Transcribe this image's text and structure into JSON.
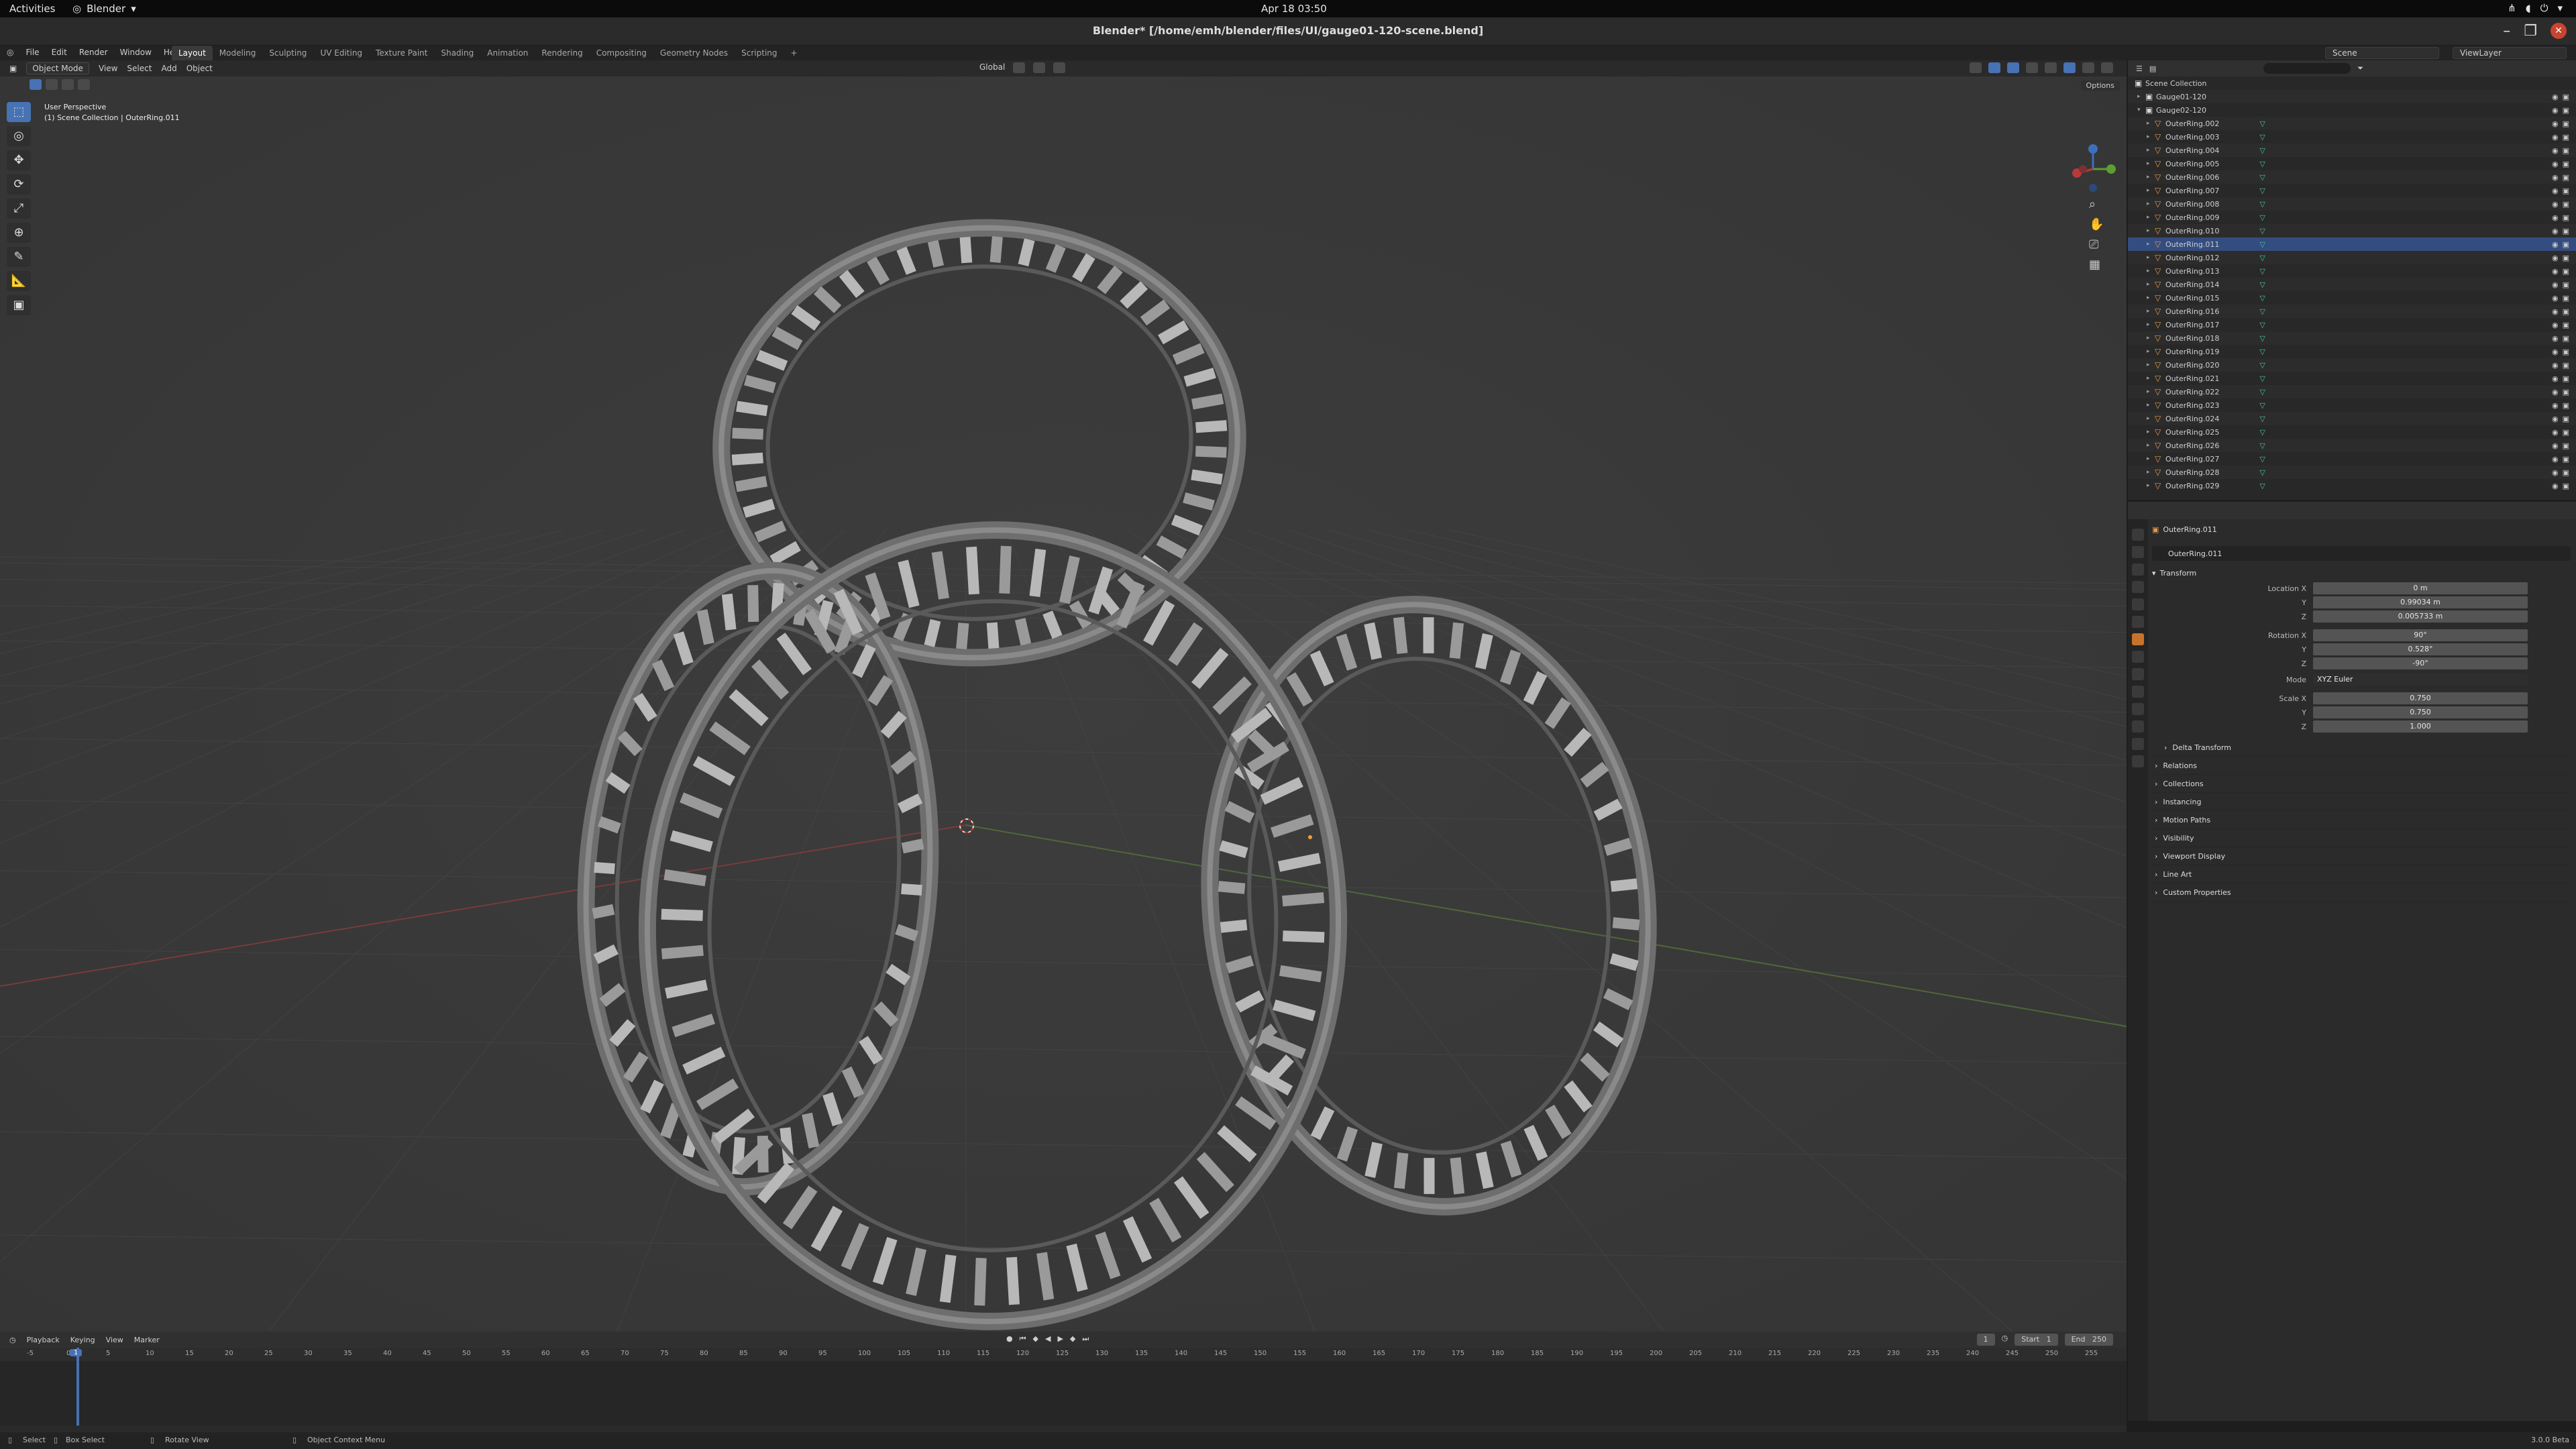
{
  "gnome": {
    "activities": "Activities",
    "app_name": "Blender",
    "clock": "Apr 18  03:50"
  },
  "window": {
    "title": "Blender* [/home/emh/blender/files/UI/gauge01-120-scene.blend]"
  },
  "menu": [
    "File",
    "Edit",
    "Render",
    "Window",
    "Help"
  ],
  "workspaces": {
    "active": "Layout",
    "tabs": [
      "Layout",
      "Modeling",
      "Sculpting",
      "UV Editing",
      "Texture Paint",
      "Shading",
      "Animation",
      "Rendering",
      "Compositing",
      "Geometry Nodes",
      "Scripting"
    ],
    "add": "+"
  },
  "topbar_right": {
    "scene": "Scene",
    "view_layer": "ViewLayer"
  },
  "viewport": {
    "mode": "Object Mode",
    "menus": [
      "View",
      "Select",
      "Add",
      "Object"
    ],
    "transform_orientation": "Global",
    "options": "Options",
    "info_line1": "User Perspective",
    "info_line2": "(1) Scene Collection | OuterRing.011"
  },
  "outliner": {
    "root": "Scene Collection",
    "collections": [
      "Gauge01-120",
      "Gauge02-120"
    ],
    "items": [
      "OuterRing.002",
      "OuterRing.003",
      "OuterRing.004",
      "OuterRing.005",
      "OuterRing.006",
      "OuterRing.007",
      "OuterRing.008",
      "OuterRing.009",
      "OuterRing.010",
      "OuterRing.011",
      "OuterRing.012",
      "OuterRing.013",
      "OuterRing.014",
      "OuterRing.015",
      "OuterRing.016",
      "OuterRing.017",
      "OuterRing.018",
      "OuterRing.019",
      "OuterRing.020",
      "OuterRing.021",
      "OuterRing.022",
      "OuterRing.023",
      "OuterRing.024",
      "OuterRing.025",
      "OuterRing.026",
      "OuterRing.027",
      "OuterRing.028",
      "OuterRing.029"
    ],
    "selected": "OuterRing.011"
  },
  "properties": {
    "object_name": "OuterRing.011",
    "name_field": "OuterRing.011",
    "transform_title": "Transform",
    "location": {
      "label": "Location X",
      "x": "0 m",
      "y": "0.99034 m",
      "z": "0.005733 m"
    },
    "rotation": {
      "label": "Rotation X",
      "x": "90°",
      "y": "0.528°",
      "z": "-90°"
    },
    "mode_label": "Mode",
    "mode_value": "XYZ Euler",
    "scale": {
      "label": "Scale X",
      "x": "0.750",
      "y": "0.750",
      "z": "1.000"
    },
    "axis_y": "Y",
    "axis_z": "Z",
    "delta": "Delta Transform",
    "panels": [
      "Relations",
      "Collections",
      "Instancing",
      "Motion Paths",
      "Visibility",
      "Viewport Display",
      "Line Art",
      "Custom Properties"
    ]
  },
  "timeline": {
    "menus": [
      "Playback",
      "Keying",
      "View",
      "Marker"
    ],
    "current_frame": "1",
    "start_label": "Start",
    "start": "1",
    "end_label": "End",
    "end": "250",
    "ticks": [
      "-5",
      "0",
      "5",
      "10",
      "15",
      "20",
      "25",
      "30",
      "35",
      "40",
      "45",
      "50",
      "55",
      "60",
      "65",
      "70",
      "75",
      "80",
      "85",
      "90",
      "95",
      "100",
      "105",
      "110",
      "115",
      "120",
      "125",
      "130",
      "135",
      "140",
      "145",
      "150",
      "155",
      "160",
      "165",
      "170",
      "175",
      "180",
      "185",
      "190",
      "195",
      "200",
      "205",
      "210",
      "215",
      "220",
      "225",
      "230",
      "235",
      "240",
      "245",
      "250",
      "255"
    ]
  },
  "status": {
    "select": "Select",
    "box_select": "Box Select",
    "rotate_view": "Rotate View",
    "context_menu": "Object Context Menu",
    "version": "3.0.0 Beta"
  },
  "colors": {
    "accent": "#4772b3",
    "object_orange": "#c8722b",
    "mesh_green": "#4ec1a0"
  }
}
